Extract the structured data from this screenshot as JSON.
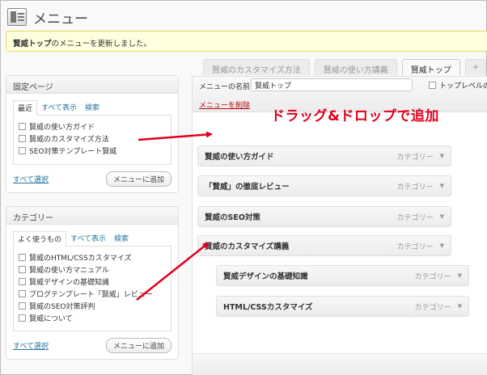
{
  "page": {
    "title": "メニュー"
  },
  "notice": {
    "strong": "賢威トップ",
    "rest": "のメニューを更新しました。"
  },
  "menu_tabs": [
    {
      "label": "賢威のカスタマイズ方法",
      "active": false
    },
    {
      "label": "賢威の使い方講義",
      "active": false
    },
    {
      "label": "賢威トップ",
      "active": true
    },
    {
      "label": "+",
      "active": false
    }
  ],
  "pages_box": {
    "title": "固定ページ",
    "tabs": [
      "最近",
      "すべて表示",
      "検索"
    ],
    "items": [
      "賢威の使い方ガイド",
      "賢威のカスタマイズ方法",
      "SEO対策テンプレート賢威"
    ],
    "select_all": "すべて選択",
    "add_button": "メニューに追加"
  },
  "categories_box": {
    "title": "カテゴリー",
    "tabs": [
      "よく使うもの",
      "すべて表示",
      "検索"
    ],
    "items": [
      "賢威のHTML/CSSカスタマイズ",
      "賢威の使い方マニュアル",
      "賢威デザインの基礎知識",
      "ブログテンプレート「賢威」レビュー",
      "賢威のSEO対策評判",
      "賢威について"
    ],
    "select_all": "すべて選択",
    "add_button": "メニューに追加"
  },
  "menu_editor": {
    "name_label": "メニューの名前",
    "name_value": "賢威トップ",
    "top_level_label": "トップレベルのペ",
    "delete_link": "メニューを削除",
    "items": [
      {
        "title": "賢威の使い方ガイド",
        "type": "カテゴリー",
        "depth": 0
      },
      {
        "title": "「賢威」の徹底レビュー",
        "type": "カテゴリー",
        "depth": 0
      },
      {
        "title": "賢威のSEO対策",
        "type": "カテゴリー",
        "depth": 0
      },
      {
        "title": "賢威のカスタマイズ講義",
        "type": "カテゴリー",
        "depth": 0
      },
      {
        "title": "賢威デザインの基礎知識",
        "type": "カテゴリー",
        "depth": 1
      },
      {
        "title": "HTML/CSSカスタマイズ",
        "type": "カテゴリー",
        "depth": 1
      }
    ]
  },
  "annotation": {
    "text": "ドラッグ&ドロップで追加",
    "color": "#e0001a"
  },
  "icons": {
    "arrow_down": "▼"
  }
}
